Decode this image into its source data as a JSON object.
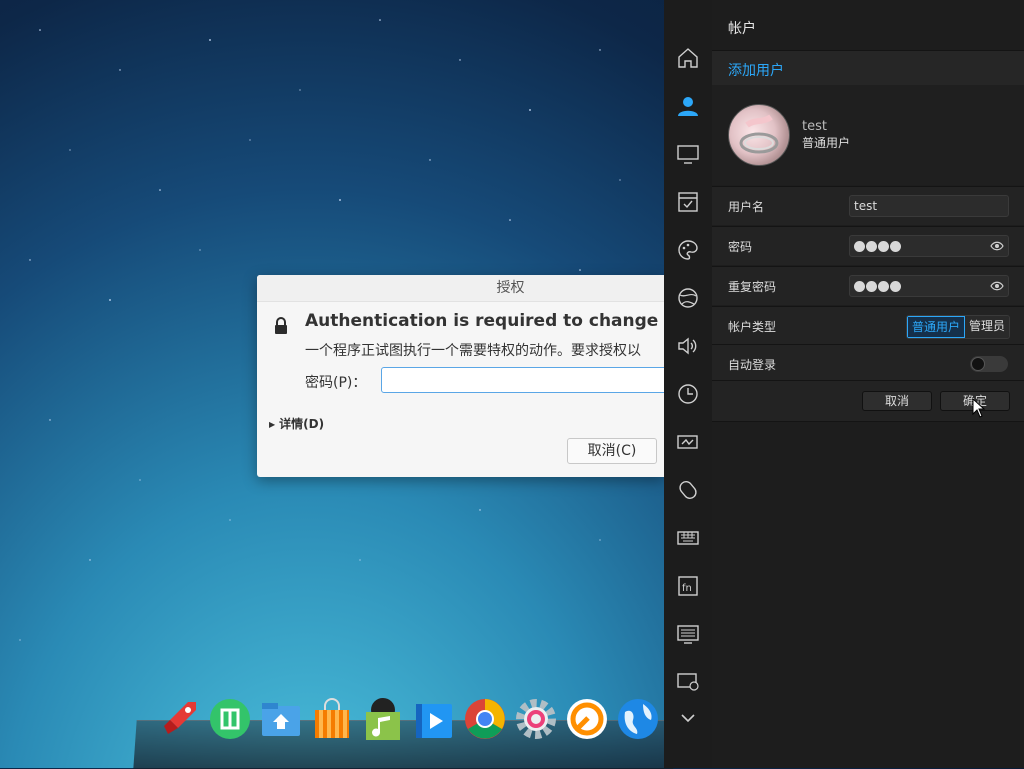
{
  "auth_dialog": {
    "title": "授权",
    "heading": "Authentication is required to change user d",
    "description": "一个程序正试图执行一个需要特权的动作。要求授权以",
    "password_label": "密码(P)：",
    "password_value": "",
    "details_label": "详情(D)",
    "cancel_label": "取消(C)"
  },
  "dock": {
    "apps": [
      "launcher-icon",
      "deepin-store-icon",
      "file-manager-icon",
      "app-store-icon",
      "music-icon",
      "video-icon",
      "chrome-icon",
      "settings-icon",
      "deepin-icon",
      "browser-icon"
    ]
  },
  "control_center": {
    "nav_icons": [
      "home-icon",
      "account-icon",
      "display-icon",
      "default-apps-icon",
      "personalization-icon",
      "network-icon",
      "sound-icon",
      "time-icon",
      "power-icon",
      "mouse-icon",
      "keyboard-icon",
      "shortcuts-icon",
      "update-icon",
      "system-info-icon",
      "more-icon"
    ],
    "title": "帐户",
    "add_user": "添加用户",
    "user": {
      "name": "test",
      "type": "普通用户"
    },
    "form": {
      "username_label": "用户名",
      "username_value": "test",
      "password_label": "密码",
      "repeat_password_label": "重复密码",
      "account_type_label": "帐户类型",
      "account_type_options": [
        "普通用户",
        "管理员"
      ],
      "account_type_selected": "普通用户",
      "auto_login_label": "自动登录",
      "auto_login_enabled": false
    },
    "buttons": {
      "cancel": "取消",
      "confirm": "确定"
    }
  },
  "colors": {
    "accent": "#2ca7f8",
    "panel_bg": "#1d1d1d",
    "dialog_bg": "#f6f6f6"
  }
}
